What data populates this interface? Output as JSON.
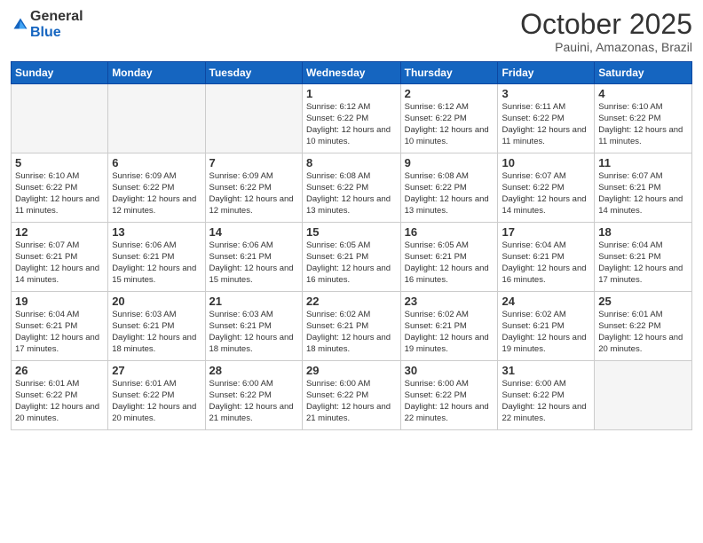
{
  "logo": {
    "general": "General",
    "blue": "Blue"
  },
  "title": "October 2025",
  "subtitle": "Pauini, Amazonas, Brazil",
  "days_of_week": [
    "Sunday",
    "Monday",
    "Tuesday",
    "Wednesday",
    "Thursday",
    "Friday",
    "Saturday"
  ],
  "weeks": [
    [
      {
        "day": "",
        "sunrise": "",
        "sunset": "",
        "daylight": ""
      },
      {
        "day": "",
        "sunrise": "",
        "sunset": "",
        "daylight": ""
      },
      {
        "day": "",
        "sunrise": "",
        "sunset": "",
        "daylight": ""
      },
      {
        "day": "1",
        "sunrise": "Sunrise: 6:12 AM",
        "sunset": "Sunset: 6:22 PM",
        "daylight": "Daylight: 12 hours and 10 minutes."
      },
      {
        "day": "2",
        "sunrise": "Sunrise: 6:12 AM",
        "sunset": "Sunset: 6:22 PM",
        "daylight": "Daylight: 12 hours and 10 minutes."
      },
      {
        "day": "3",
        "sunrise": "Sunrise: 6:11 AM",
        "sunset": "Sunset: 6:22 PM",
        "daylight": "Daylight: 12 hours and 11 minutes."
      },
      {
        "day": "4",
        "sunrise": "Sunrise: 6:10 AM",
        "sunset": "Sunset: 6:22 PM",
        "daylight": "Daylight: 12 hours and 11 minutes."
      }
    ],
    [
      {
        "day": "5",
        "sunrise": "Sunrise: 6:10 AM",
        "sunset": "Sunset: 6:22 PM",
        "daylight": "Daylight: 12 hours and 11 minutes."
      },
      {
        "day": "6",
        "sunrise": "Sunrise: 6:09 AM",
        "sunset": "Sunset: 6:22 PM",
        "daylight": "Daylight: 12 hours and 12 minutes."
      },
      {
        "day": "7",
        "sunrise": "Sunrise: 6:09 AM",
        "sunset": "Sunset: 6:22 PM",
        "daylight": "Daylight: 12 hours and 12 minutes."
      },
      {
        "day": "8",
        "sunrise": "Sunrise: 6:08 AM",
        "sunset": "Sunset: 6:22 PM",
        "daylight": "Daylight: 12 hours and 13 minutes."
      },
      {
        "day": "9",
        "sunrise": "Sunrise: 6:08 AM",
        "sunset": "Sunset: 6:22 PM",
        "daylight": "Daylight: 12 hours and 13 minutes."
      },
      {
        "day": "10",
        "sunrise": "Sunrise: 6:07 AM",
        "sunset": "Sunset: 6:22 PM",
        "daylight": "Daylight: 12 hours and 14 minutes."
      },
      {
        "day": "11",
        "sunrise": "Sunrise: 6:07 AM",
        "sunset": "Sunset: 6:21 PM",
        "daylight": "Daylight: 12 hours and 14 minutes."
      }
    ],
    [
      {
        "day": "12",
        "sunrise": "Sunrise: 6:07 AM",
        "sunset": "Sunset: 6:21 PM",
        "daylight": "Daylight: 12 hours and 14 minutes."
      },
      {
        "day": "13",
        "sunrise": "Sunrise: 6:06 AM",
        "sunset": "Sunset: 6:21 PM",
        "daylight": "Daylight: 12 hours and 15 minutes."
      },
      {
        "day": "14",
        "sunrise": "Sunrise: 6:06 AM",
        "sunset": "Sunset: 6:21 PM",
        "daylight": "Daylight: 12 hours and 15 minutes."
      },
      {
        "day": "15",
        "sunrise": "Sunrise: 6:05 AM",
        "sunset": "Sunset: 6:21 PM",
        "daylight": "Daylight: 12 hours and 16 minutes."
      },
      {
        "day": "16",
        "sunrise": "Sunrise: 6:05 AM",
        "sunset": "Sunset: 6:21 PM",
        "daylight": "Daylight: 12 hours and 16 minutes."
      },
      {
        "day": "17",
        "sunrise": "Sunrise: 6:04 AM",
        "sunset": "Sunset: 6:21 PM",
        "daylight": "Daylight: 12 hours and 16 minutes."
      },
      {
        "day": "18",
        "sunrise": "Sunrise: 6:04 AM",
        "sunset": "Sunset: 6:21 PM",
        "daylight": "Daylight: 12 hours and 17 minutes."
      }
    ],
    [
      {
        "day": "19",
        "sunrise": "Sunrise: 6:04 AM",
        "sunset": "Sunset: 6:21 PM",
        "daylight": "Daylight: 12 hours and 17 minutes."
      },
      {
        "day": "20",
        "sunrise": "Sunrise: 6:03 AM",
        "sunset": "Sunset: 6:21 PM",
        "daylight": "Daylight: 12 hours and 18 minutes."
      },
      {
        "day": "21",
        "sunrise": "Sunrise: 6:03 AM",
        "sunset": "Sunset: 6:21 PM",
        "daylight": "Daylight: 12 hours and 18 minutes."
      },
      {
        "day": "22",
        "sunrise": "Sunrise: 6:02 AM",
        "sunset": "Sunset: 6:21 PM",
        "daylight": "Daylight: 12 hours and 18 minutes."
      },
      {
        "day": "23",
        "sunrise": "Sunrise: 6:02 AM",
        "sunset": "Sunset: 6:21 PM",
        "daylight": "Daylight: 12 hours and 19 minutes."
      },
      {
        "day": "24",
        "sunrise": "Sunrise: 6:02 AM",
        "sunset": "Sunset: 6:21 PM",
        "daylight": "Daylight: 12 hours and 19 minutes."
      },
      {
        "day": "25",
        "sunrise": "Sunrise: 6:01 AM",
        "sunset": "Sunset: 6:22 PM",
        "daylight": "Daylight: 12 hours and 20 minutes."
      }
    ],
    [
      {
        "day": "26",
        "sunrise": "Sunrise: 6:01 AM",
        "sunset": "Sunset: 6:22 PM",
        "daylight": "Daylight: 12 hours and 20 minutes."
      },
      {
        "day": "27",
        "sunrise": "Sunrise: 6:01 AM",
        "sunset": "Sunset: 6:22 PM",
        "daylight": "Daylight: 12 hours and 20 minutes."
      },
      {
        "day": "28",
        "sunrise": "Sunrise: 6:00 AM",
        "sunset": "Sunset: 6:22 PM",
        "daylight": "Daylight: 12 hours and 21 minutes."
      },
      {
        "day": "29",
        "sunrise": "Sunrise: 6:00 AM",
        "sunset": "Sunset: 6:22 PM",
        "daylight": "Daylight: 12 hours and 21 minutes."
      },
      {
        "day": "30",
        "sunrise": "Sunrise: 6:00 AM",
        "sunset": "Sunset: 6:22 PM",
        "daylight": "Daylight: 12 hours and 22 minutes."
      },
      {
        "day": "31",
        "sunrise": "Sunrise: 6:00 AM",
        "sunset": "Sunset: 6:22 PM",
        "daylight": "Daylight: 12 hours and 22 minutes."
      },
      {
        "day": "",
        "sunrise": "",
        "sunset": "",
        "daylight": ""
      }
    ]
  ]
}
